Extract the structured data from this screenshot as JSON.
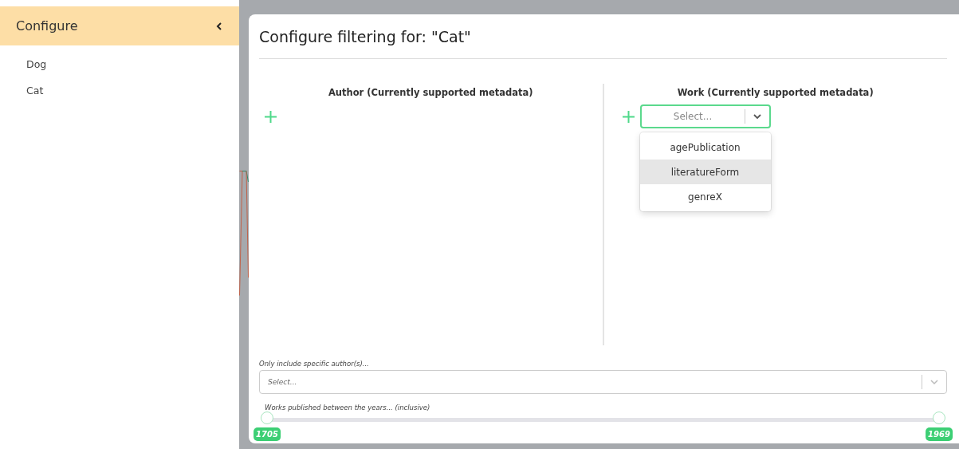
{
  "sidebar": {
    "title": "Configure",
    "items": [
      {
        "label": "Dog"
      },
      {
        "label": "Cat"
      }
    ]
  },
  "dialog": {
    "title": "Configure filtering for: \"Cat\"",
    "columns": [
      {
        "heading": "Author (Currently supported metadata)"
      },
      {
        "heading": "Work (Currently supported metadata)",
        "select": {
          "placeholder": "Select...",
          "options": [
            {
              "label": "agePublication",
              "selected": false
            },
            {
              "label": "literatureForm",
              "selected": true
            },
            {
              "label": "genreX",
              "selected": false
            }
          ]
        }
      }
    ],
    "author_filter": {
      "label": "Only include specific author(s)...",
      "placeholder": "Select..."
    },
    "years": {
      "label": "Works published between the years... (inclusive)",
      "low": {
        "level": 0,
        "value": "1705"
      },
      "high": {
        "level": 1,
        "value": "1969"
      }
    }
  }
}
